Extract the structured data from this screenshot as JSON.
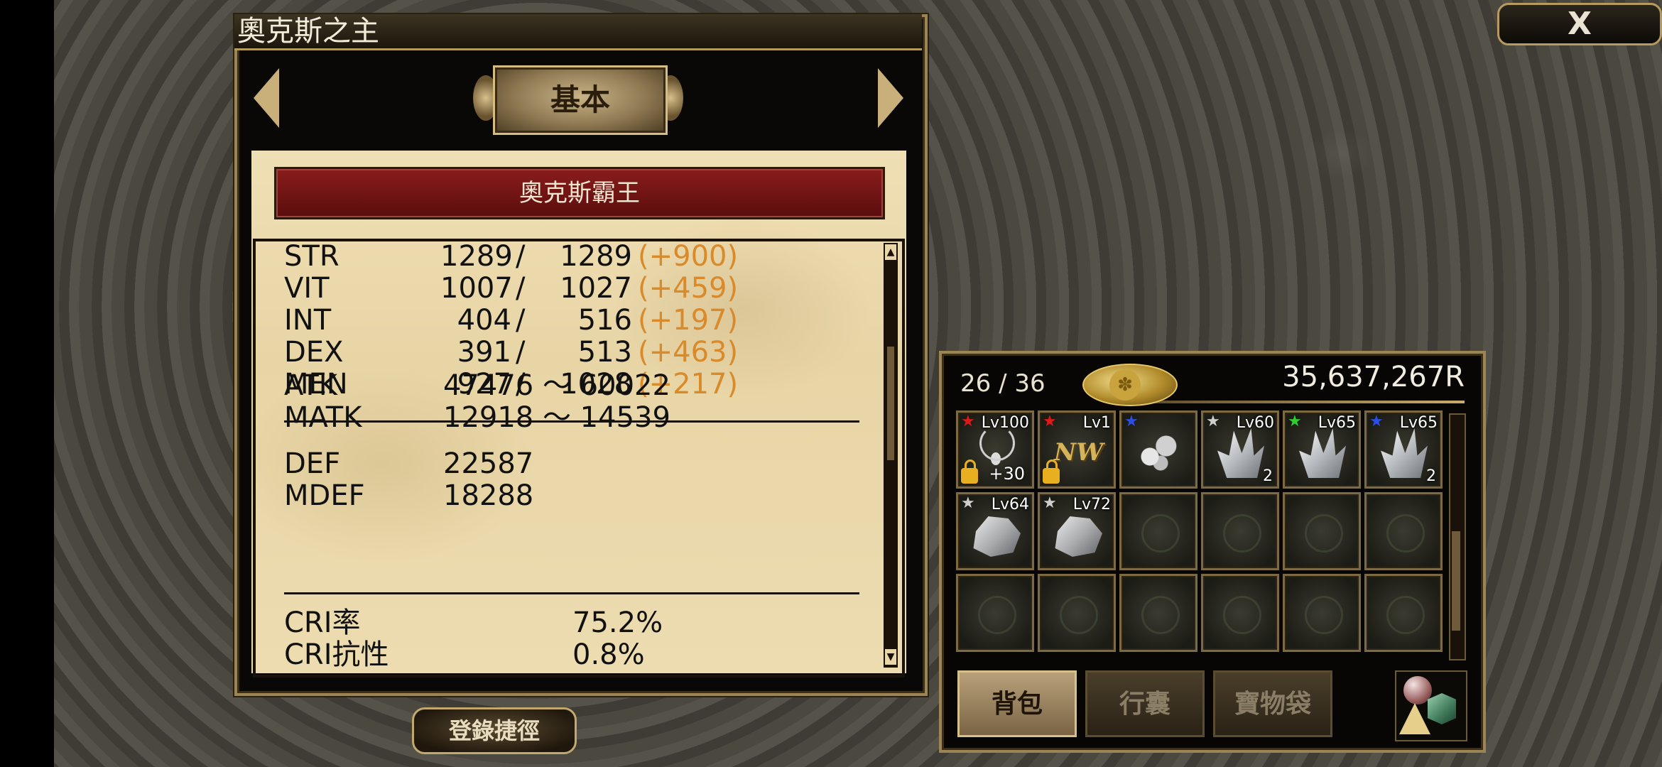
{
  "window_title": "奧克斯之主",
  "tab": {
    "label": "基本"
  },
  "character": {
    "name": "奧克斯霸王"
  },
  "attributes": [
    {
      "label": "STR",
      "current": "1289",
      "max": "1289",
      "bonus": "(+900)"
    },
    {
      "label": "VIT",
      "current": "1007",
      "max": "1027",
      "bonus": "(+459)"
    },
    {
      "label": "INT",
      "current": "404",
      "max": "516",
      "bonus": "(+197)"
    },
    {
      "label": "DEX",
      "current": "391",
      "max": "513",
      "bonus": "(+463)"
    },
    {
      "label": "MEN",
      "current": "927",
      "max": "1028",
      "bonus": "(+217)"
    }
  ],
  "attack": [
    {
      "label": "ATK",
      "value": "47476 〜 60022"
    },
    {
      "label": "MATK",
      "value": "12918 〜 14539"
    }
  ],
  "defense": [
    {
      "label": "DEF",
      "value": "22587"
    },
    {
      "label": "MDEF",
      "value": "18288"
    }
  ],
  "critical": [
    {
      "label": "CRI率",
      "value": "75.2%"
    },
    {
      "label": "CRI抗性",
      "value": "0.8%"
    }
  ],
  "shortcut_button": "登錄捷徑",
  "close_button": "X",
  "inventory": {
    "count": "26 / 36",
    "money": "35,637,267R",
    "tabs": [
      "背包",
      "行囊",
      "寶物袋"
    ],
    "items": [
      {
        "level": "Lv100",
        "star_color": "#e01818",
        "icon": "necklace-icon",
        "enhance": "+30",
        "locked": true
      },
      {
        "level": "Lv1",
        "star_color": "#e01818",
        "icon": "nw-emblem-icon",
        "locked": true
      },
      {
        "level": "",
        "star_color": "#2a4ee8",
        "icon": "white-flower-icon"
      },
      {
        "level": "Lv60",
        "star_color": "#cfcfcf",
        "icon": "crystal-icon",
        "qty": "2"
      },
      {
        "level": "Lv65",
        "star_color": "#2ed02e",
        "icon": "crystal-icon"
      },
      {
        "level": "Lv65",
        "star_color": "#2a4ee8",
        "icon": "crystal-icon",
        "qty": "2"
      },
      {
        "level": "Lv64",
        "star_color": "#cfcfcf",
        "icon": "ore-icon"
      },
      {
        "level": "Lv72",
        "star_color": "#cfcfcf",
        "icon": "ore-icon"
      }
    ]
  }
}
